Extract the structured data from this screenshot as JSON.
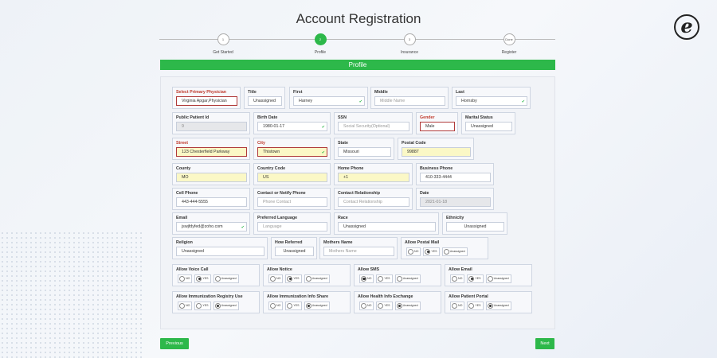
{
  "title": "Account Registration",
  "logo_icon": "e-logo-icon",
  "steps": [
    {
      "num": "1",
      "label": "Get Started"
    },
    {
      "num": "2",
      "label": "Profile"
    },
    {
      "num": "3",
      "label": "Insurance"
    },
    {
      "num": "Done",
      "label": "Register"
    }
  ],
  "active_step": 1,
  "banner": "Profile",
  "accent_color": "#2db84a",
  "error_color": "#c0392b",
  "fields": {
    "physician": {
      "label": "Select Primary Physician",
      "value": "Virginia Apgar,Physician"
    },
    "title": {
      "label": "Title",
      "value": "Unassigned"
    },
    "first": {
      "label": "First",
      "value": "Harney"
    },
    "middle": {
      "label": "Middle",
      "placeholder": "Middle Name"
    },
    "last": {
      "label": "Last",
      "value": "Hornsby"
    },
    "patient_id": {
      "label": "Public Patient Id",
      "value": "9"
    },
    "birth_date": {
      "label": "Birth Date",
      "value": "1980-01-17"
    },
    "ssn": {
      "label": "SSN",
      "placeholder": "Social Security(Optional)"
    },
    "gender": {
      "label": "Gender",
      "value": "Male"
    },
    "marital": {
      "label": "Marital Status",
      "value": "Unassigned"
    },
    "street": {
      "label": "Street",
      "value": "123 Chesterfield Parkway"
    },
    "city": {
      "label": "City",
      "value": "Thistown"
    },
    "state": {
      "label": "State",
      "value": "Missouri"
    },
    "postal": {
      "label": "Postal Code",
      "value": "99887"
    },
    "county": {
      "label": "County",
      "value": "MO"
    },
    "country_code": {
      "label": "Country Code",
      "value": "US"
    },
    "home_phone": {
      "label": "Home Phone",
      "value": "+1"
    },
    "business_phone": {
      "label": "Business Phone",
      "value": "410-333-4444"
    },
    "cell_phone": {
      "label": "Cell Phone",
      "value": "443-444-5555"
    },
    "contact": {
      "label": "Contact or Notify Phone",
      "placeholder": "Phone Contact"
    },
    "contact_rel": {
      "label": "Contact Relationship",
      "placeholder": "Contact Relationship"
    },
    "date": {
      "label": "Date",
      "value": "2021-01-18"
    },
    "email": {
      "label": "Email",
      "value": "jswjfdyfed@zoho.com"
    },
    "language": {
      "label": "Preferred Language",
      "placeholder": "Language"
    },
    "race": {
      "label": "Race",
      "value": "Unassigned"
    },
    "ethnicity": {
      "label": "Ethnicity",
      "value": "Unassigned"
    },
    "religion": {
      "label": "Religion",
      "value": "Unassigned"
    },
    "how_referred": {
      "label": "How Referred",
      "value": "Unassigned"
    },
    "mothers_name": {
      "label": "Mothers Name",
      "placeholder": "Mothers Name"
    }
  },
  "radio_labels": {
    "no": "NO",
    "yes": "YES",
    "unassigned": "Unassigned"
  },
  "radio_groups": {
    "postal_mail": {
      "label": "Allow Postal Mail",
      "selected": "yes"
    },
    "voice_call": {
      "label": "Allow Voice Call",
      "selected": "yes"
    },
    "notice": {
      "label": "Allow Notice",
      "selected": "yes"
    },
    "sms": {
      "label": "Allow SMS",
      "selected": "no"
    },
    "email": {
      "label": "Allow Email",
      "selected": "yes"
    },
    "immunization_registry": {
      "label": "Allow Immunization Registry Use",
      "selected": "unassigned"
    },
    "immunization_info": {
      "label": "Allow Immunization Info Share",
      "selected": "unassigned"
    },
    "health_info": {
      "label": "Allow Health Info Exchange",
      "selected": "unassigned"
    },
    "patient_portal": {
      "label": "Allow Patient Portal",
      "selected": "unassigned"
    }
  },
  "buttons": {
    "previous": "Previous",
    "next": "Next"
  }
}
